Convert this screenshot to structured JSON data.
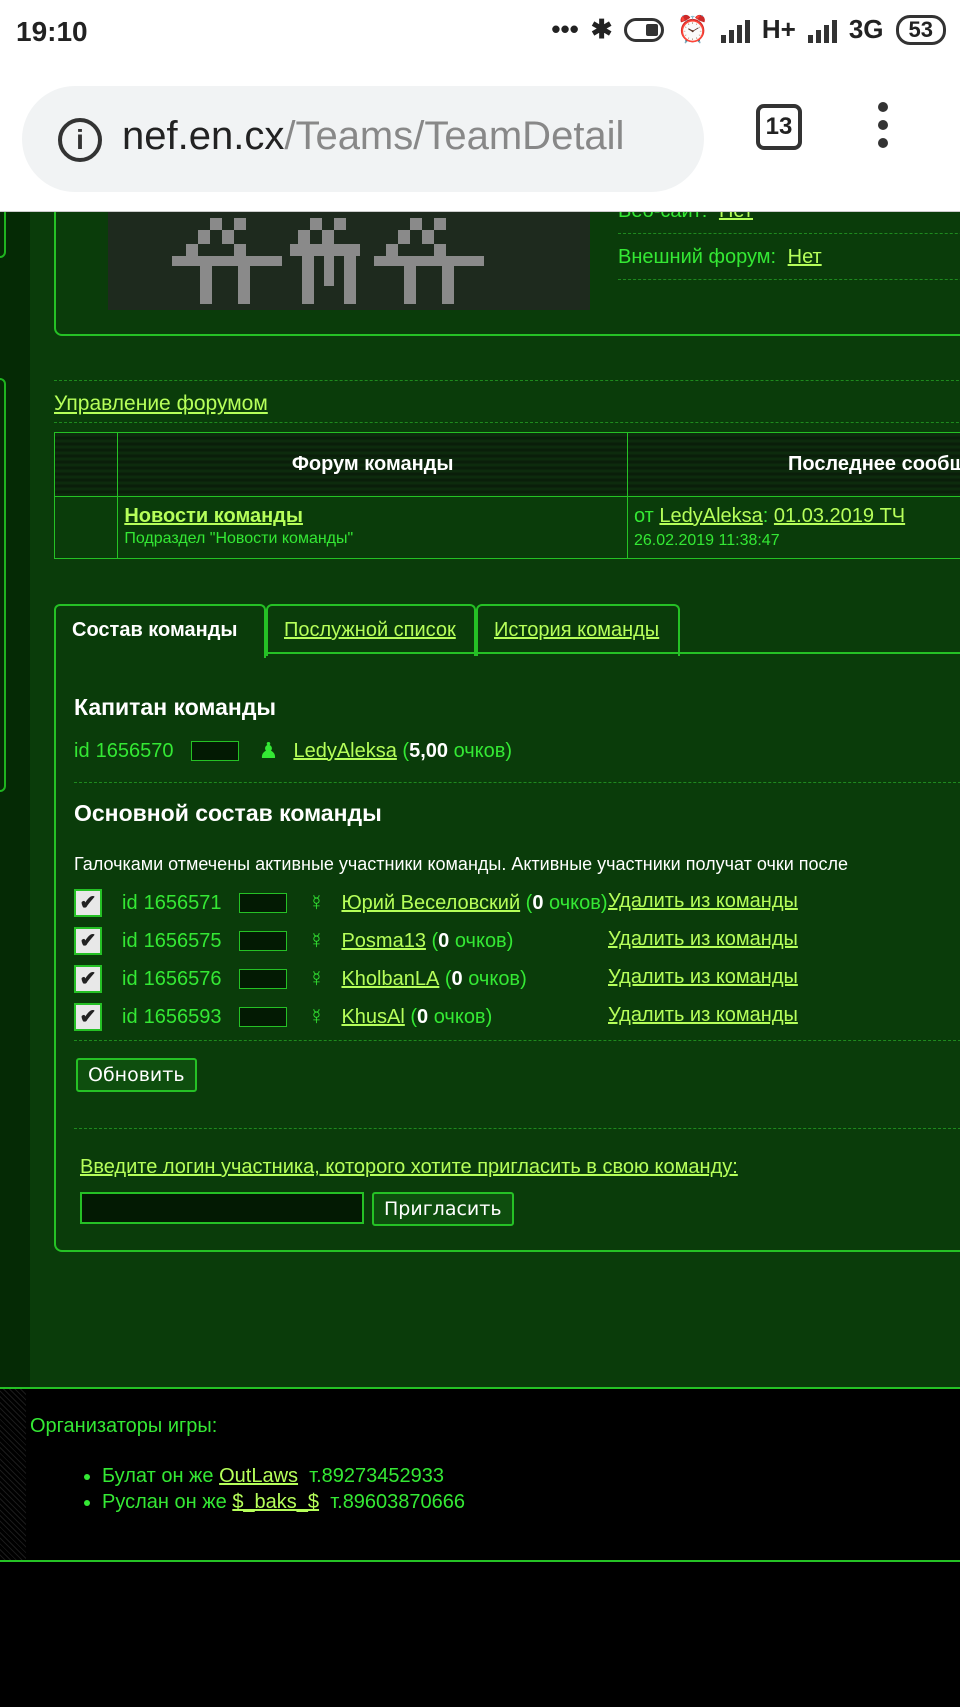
{
  "status_bar": {
    "time": "19:10",
    "network": "H+",
    "network2": "3G",
    "battery": "53",
    "icons": [
      "more-icon",
      "bluetooth-icon",
      "toggle-icon",
      "alarm-icon",
      "signal-icon",
      "signal-icon"
    ]
  },
  "browser": {
    "url_host": "nef.en.cx",
    "url_path": "/Teams/TeamDetail",
    "tab_count": "13"
  },
  "team_info": {
    "website_label": "Веб-сайт:",
    "website_value": "Нет",
    "forum_label": "Внешний форум:",
    "forum_value": "Нет"
  },
  "forum": {
    "manage_link": "Управление форумом",
    "col_forum": "Форум команды",
    "col_last": "Последнее сообщение",
    "row": {
      "name": "Новости команды",
      "subtitle": "Подраздел \"Новости команды\"",
      "from_prefix": "от",
      "from_user": "LedyAleksa",
      "last_topic": "01.03.2019 ТЧ ",
      "date": "26.02.2019 11:38:47"
    }
  },
  "tabs": [
    "Состав команды",
    "Послужной список",
    "История команды"
  ],
  "captain": {
    "heading": "Капитан команды",
    "id_label": "id",
    "id": "1656570",
    "name": "LedyAleksa",
    "points": "5,00",
    "points_unit": "очков"
  },
  "roster": {
    "heading": "Основной состав команды",
    "note": "Галочками отмечены активные участники команды. Активные участники получат очки после",
    "remove_label": "Удалить из команды",
    "members": [
      {
        "id": "1656571",
        "name": "Юрий Веселовский",
        "points": "0",
        "unit": "очков"
      },
      {
        "id": "1656575",
        "name": "Posma13",
        "points": "0",
        "unit": "очков"
      },
      {
        "id": "1656576",
        "name": "KholbanLA",
        "points": "0",
        "unit": "очков"
      },
      {
        "id": "1656593",
        "name": "KhusAl",
        "points": "0",
        "unit": "очков"
      }
    ],
    "update_button": "Обновить"
  },
  "invite": {
    "label": "Введите логин участника, которого хотите пригласить в свою команду:",
    "button": "Пригласить",
    "input_value": ""
  },
  "footer": {
    "title": "Организаторы игры:",
    "organizers": [
      {
        "prefix": "Булат он же",
        "nick": "OutLaws",
        "phone": "т.89273452933"
      },
      {
        "prefix": "Руслан он же",
        "nick": "$_baks_$",
        "phone": "т.89603870666"
      }
    ]
  },
  "colors": {
    "page_bg": "#0a3c0a",
    "accent_green": "#34e834",
    "link": "#b6ff5a",
    "border": "#25c125"
  }
}
